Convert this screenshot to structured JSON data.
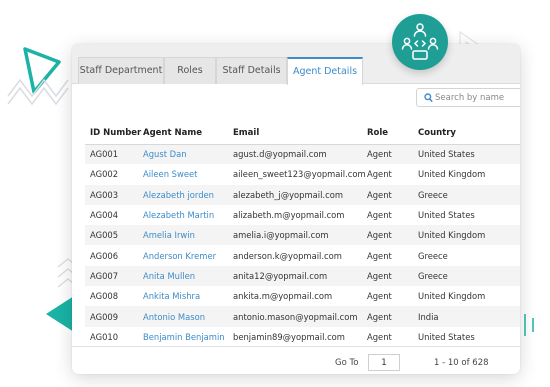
{
  "tabs": [
    {
      "label": "Staff Department"
    },
    {
      "label": "Roles"
    },
    {
      "label": "Staff Details"
    },
    {
      "label": "Agent Details"
    }
  ],
  "search": {
    "placeholder": "Search by name",
    "value": ""
  },
  "table": {
    "headers": [
      "ID Number",
      "Agent Name",
      "Email",
      "Role",
      "Country"
    ],
    "rows": [
      {
        "id": "AG001",
        "name": "Agust Dan",
        "email": "agust.d@yopmail.com",
        "role": "Agent",
        "country": "United States"
      },
      {
        "id": "AG002",
        "name": "Aileen Sweet",
        "email": "aileen_sweet123@yopmail.com",
        "role": "Agent",
        "country": "United Kingdom"
      },
      {
        "id": "AG003",
        "name": "Alezabeth jorden",
        "email": "alezabeth_j@yopmail.com",
        "role": "Agent",
        "country": "Greece"
      },
      {
        "id": "AG004",
        "name": "Alezabeth Martin",
        "email": "alizabeth.m@yopmail.com",
        "role": "Agent",
        "country": "United States"
      },
      {
        "id": "AG005",
        "name": "Amelia Irwin",
        "email": "amelia.i@yopmail.com",
        "role": "Agent",
        "country": "United Kingdom"
      },
      {
        "id": "AG006",
        "name": "Anderson Kremer",
        "email": "anderson.k@yopmail.com",
        "role": "Agent",
        "country": "Greece"
      },
      {
        "id": "AG007",
        "name": "Anita Mullen",
        "email": "anita12@yopmail.com",
        "role": "Agent",
        "country": "Greece"
      },
      {
        "id": "AG008",
        "name": "Ankita Mishra",
        "email": "ankita.m@yopmail.com",
        "role": "Agent",
        "country": "United Kingdom"
      },
      {
        "id": "AG009",
        "name": "Antonio Mason",
        "email": "antonio.mason@yopmail.com",
        "role": "Agent",
        "country": "India"
      },
      {
        "id": "AG010",
        "name": "Benjamin Benjamin",
        "email": "benjamin89@yopmail.com",
        "role": "Agent",
        "country": "United States"
      }
    ]
  },
  "pager": {
    "goto_label": "Go To",
    "goto_value": "1",
    "info": "1 - 10 of 628"
  },
  "icons": {
    "search": "search-icon",
    "badge": "agent-network-icon"
  },
  "colors": {
    "accent": "#3d8bc9",
    "badge": "#1e9e94",
    "deco_teal": "#1ab3a6"
  }
}
